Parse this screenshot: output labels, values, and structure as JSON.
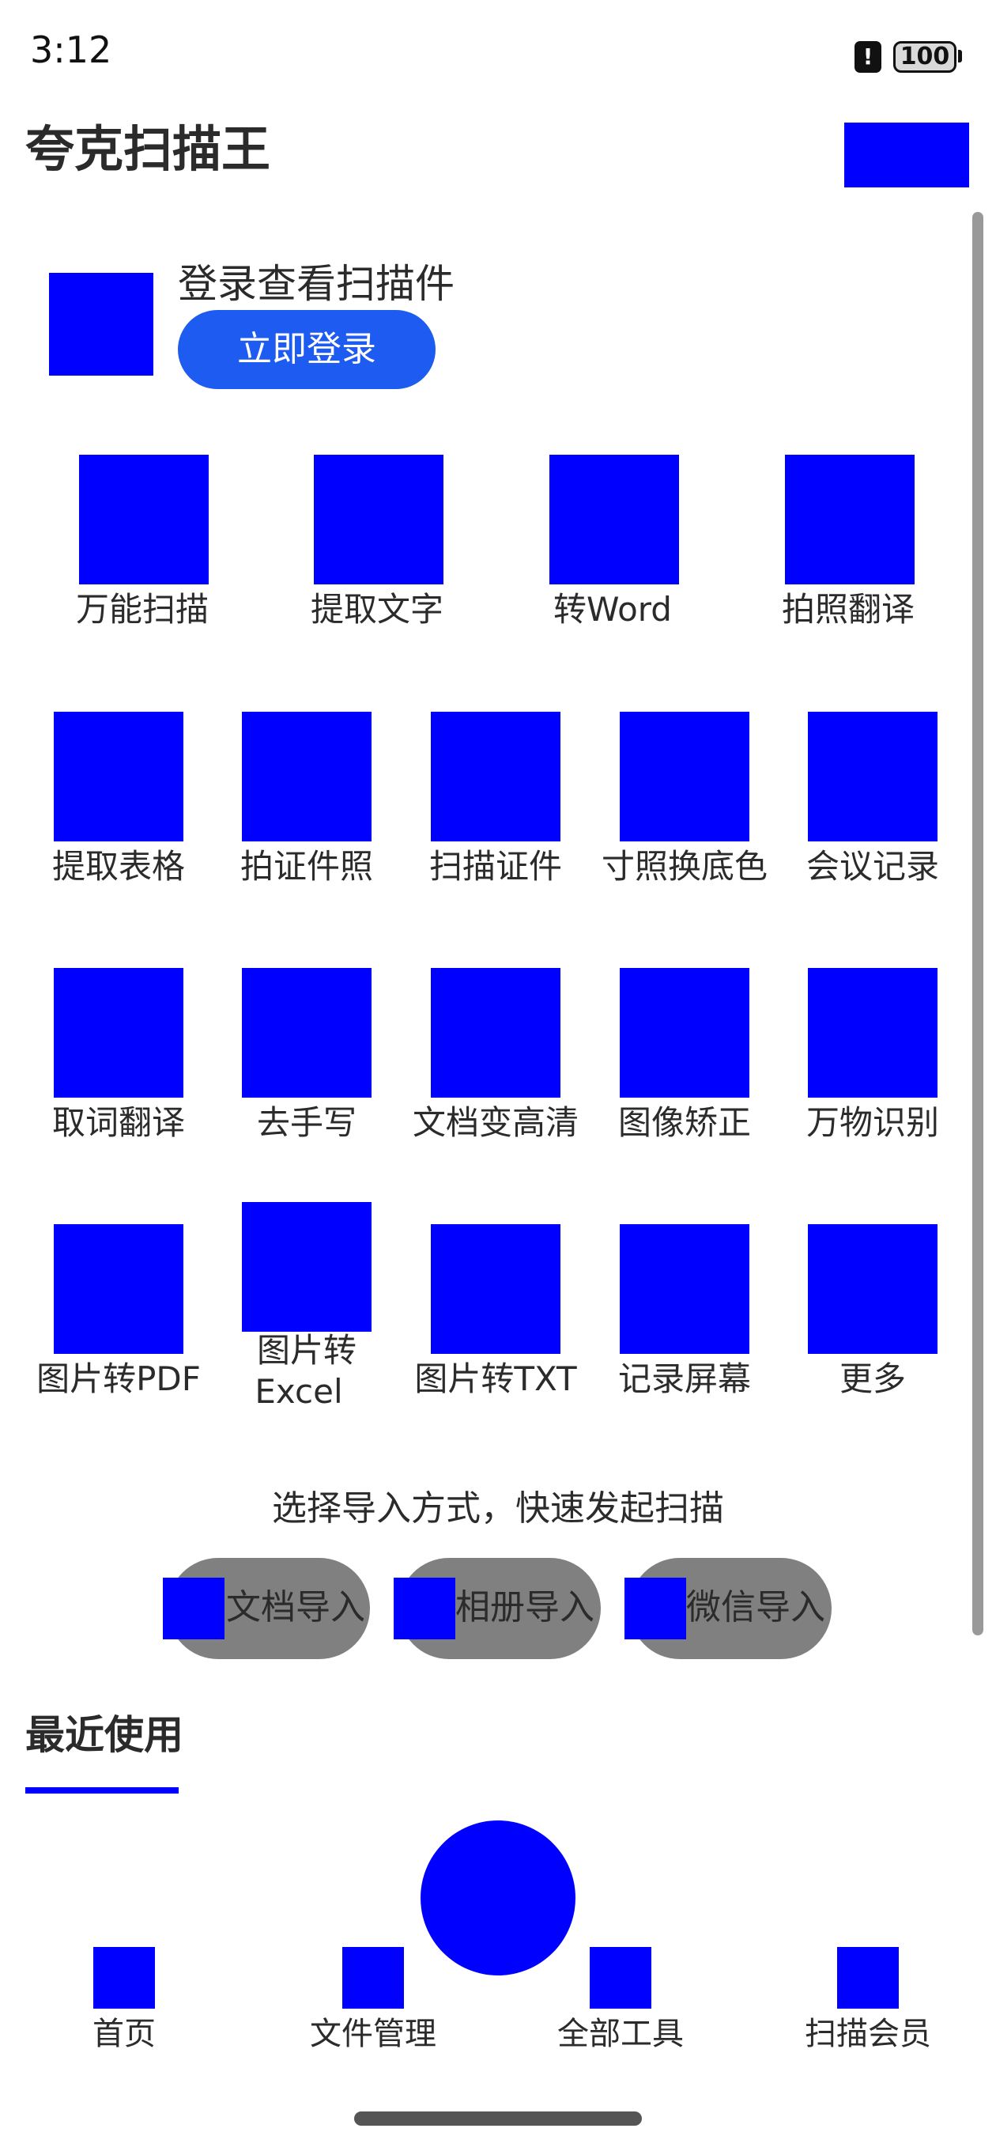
{
  "status_bar": {
    "time": "3:12",
    "alert_glyph": "!",
    "battery": "100"
  },
  "header": {
    "title": "夸克扫描王"
  },
  "login": {
    "prompt": "登录查看扫描件",
    "button_label": "立即登录"
  },
  "tools": {
    "row1": [
      "万能扫描",
      "提取文字",
      "转Word",
      "拍照翻译"
    ],
    "row2": [
      "提取表格",
      "拍证件照",
      "扫描证件",
      "寸照换底色",
      "会议记录"
    ],
    "row3": [
      "取词翻译",
      "去手写",
      "文档变高清",
      "图像矫正",
      "万物识别"
    ],
    "row4": [
      {
        "line1": "图片转PDF",
        "line2": ""
      },
      {
        "line1": "图片转",
        "line2": "Excel"
      },
      {
        "line1": "图片转TXT",
        "line2": ""
      },
      {
        "line1": "记录屏幕",
        "line2": ""
      },
      {
        "line1": "更多",
        "line2": ""
      }
    ]
  },
  "import": {
    "title": "选择导入方式，快速发起扫描",
    "options": [
      "文档导入",
      "相册导入",
      "微信导入"
    ]
  },
  "recent": {
    "title": "最近使用"
  },
  "bottom_nav": [
    "首页",
    "文件管理",
    "全部工具",
    "扫描会员"
  ],
  "colors": {
    "placeholder": "#0000ff",
    "login_button": "#1e5bf0",
    "import_pill": "#808080"
  }
}
